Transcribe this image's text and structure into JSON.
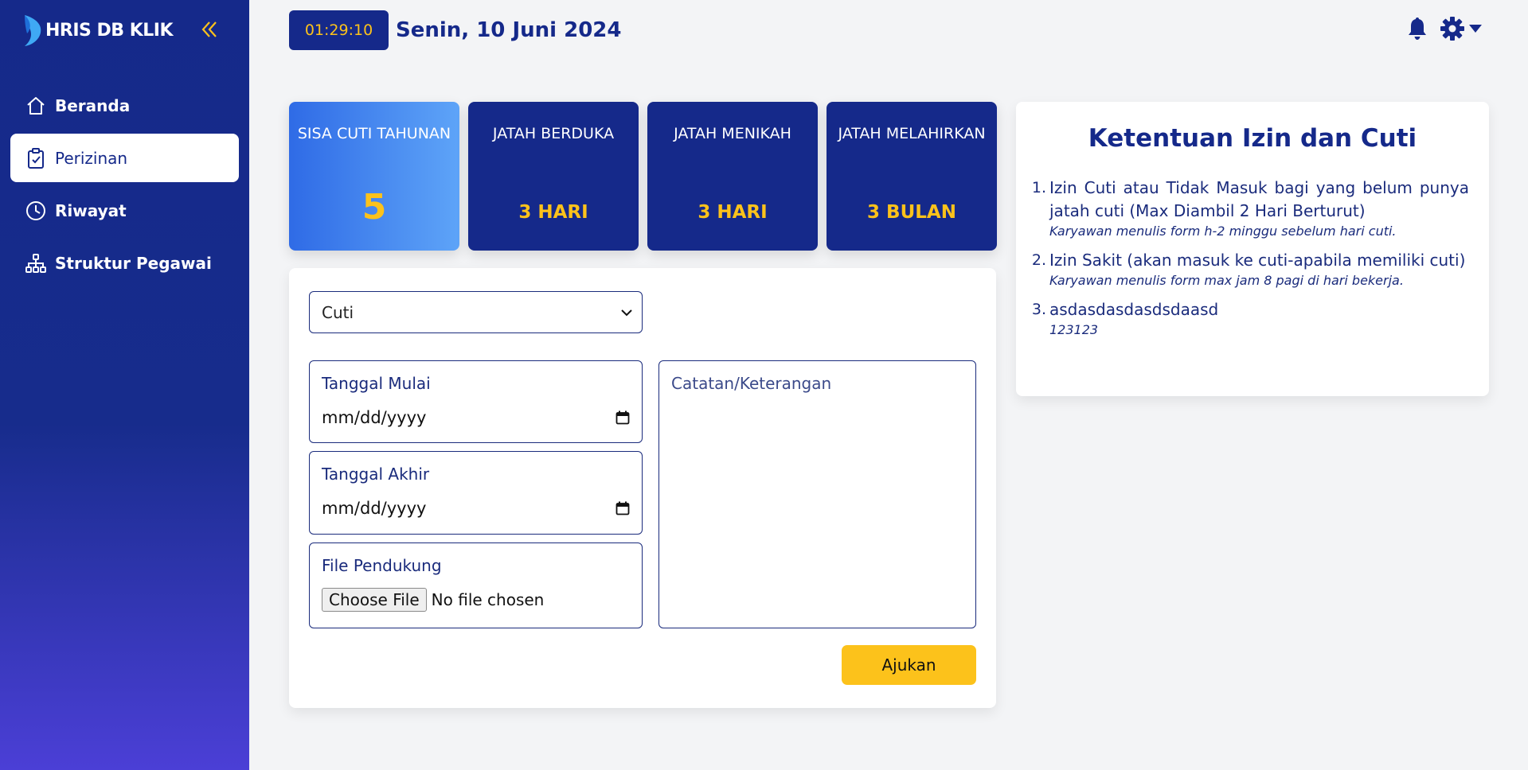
{
  "brand": {
    "name": "HRIS DB KLIK"
  },
  "header": {
    "time": "01:29:10",
    "date": "Senin, 10 Juni 2024"
  },
  "sidebar": {
    "items": [
      {
        "label": "Beranda",
        "icon": "home-icon"
      },
      {
        "label": "Perizinan",
        "icon": "clipboard-check-icon",
        "active": true
      },
      {
        "label": "Riwayat",
        "icon": "clock-history-icon"
      },
      {
        "label": "Struktur Pegawai",
        "icon": "org-chart-icon"
      }
    ]
  },
  "cards": [
    {
      "title": "SISA CUTI TAHUNAN",
      "value": "5"
    },
    {
      "title": "JATAH BERDUKA",
      "value": "3 HARI"
    },
    {
      "title": "JATAH MENIKAH",
      "value": "3 HARI"
    },
    {
      "title": "JATAH MELAHIRKAN",
      "value": "3 BULAN"
    }
  ],
  "form": {
    "type_selected": "Cuti",
    "start_label": "Tanggal Mulai",
    "start_placeholder": "mm/dd/yyyy",
    "end_label": "Tanggal Akhir",
    "end_placeholder": "mm/dd/yyyy",
    "file_label": "File Pendukung",
    "file_button": "Choose File",
    "file_status": "No file chosen",
    "notes_placeholder": "Catatan/Keterangan",
    "submit_label": "Ajukan"
  },
  "rules": {
    "title": "Ketentuan Izin dan Cuti",
    "items": [
      {
        "num": "1.",
        "text": "Izin Cuti atau Tidak Masuk bagi yang belum punya jatah cuti (Max Diambil 2 Hari Berturut)",
        "note": "Karyawan menulis form h-2 minggu sebelum hari cuti."
      },
      {
        "num": "2.",
        "text": "Izin Sakit (akan masuk ke cuti-apabila memiliki cuti)",
        "note": "Karyawan menulis form max jam 8 pagi di hari bekerja."
      },
      {
        "num": "3.",
        "text": "asdasdasdasdsdaasd",
        "note": "123123"
      }
    ]
  },
  "colors": {
    "navy": "#15298a",
    "accent": "#fcc21b",
    "card_gradient_start": "#2f6be6",
    "card_gradient_end": "#5ea4f8"
  }
}
